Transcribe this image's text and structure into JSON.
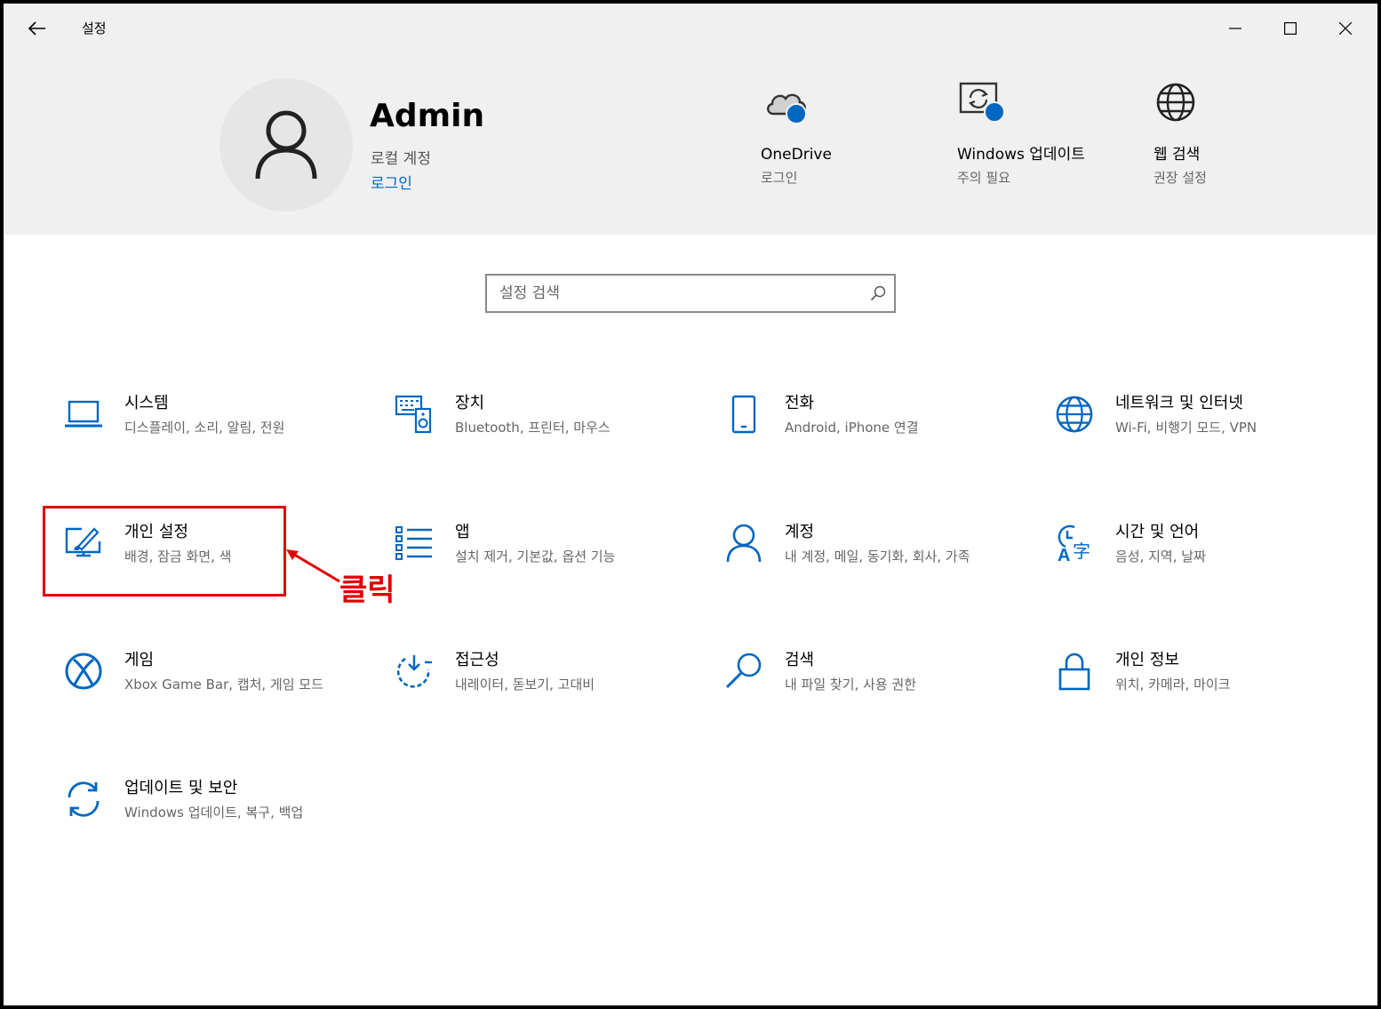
{
  "window": {
    "title": "설정"
  },
  "account": {
    "name": "Admin",
    "type": "로컬 계정",
    "signin": "로그인"
  },
  "quick": [
    {
      "title": "OneDrive",
      "sub": "로그인",
      "icon": "cloud-icon"
    },
    {
      "title": "Windows 업데이트",
      "sub": "주의 필요",
      "icon": "update-screen-icon"
    },
    {
      "title": "웹 검색",
      "sub": "권장 설정",
      "icon": "globe-icon"
    }
  ],
  "search": {
    "placeholder": "설정 검색"
  },
  "categories": [
    {
      "title": "시스템",
      "desc": "디스플레이, 소리, 알림, 전원",
      "icon": "laptop-icon"
    },
    {
      "title": "장치",
      "desc": "Bluetooth, 프린터, 마우스",
      "icon": "keyboard-speaker-icon"
    },
    {
      "title": "전화",
      "desc": "Android, iPhone 연결",
      "icon": "phone-icon"
    },
    {
      "title": "네트워크 및 인터넷",
      "desc": "Wi-Fi, 비행기 모드, VPN",
      "icon": "globe-icon"
    },
    {
      "title": "개인 설정",
      "desc": "배경, 잠금 화면, 색",
      "icon": "paintbrush-monitor-icon"
    },
    {
      "title": "앱",
      "desc": "설치 제거, 기본값, 옵션 기능",
      "icon": "list-icon"
    },
    {
      "title": "계정",
      "desc": "내 계정, 메일, 동기화, 회사, 가족",
      "icon": "person-icon"
    },
    {
      "title": "시간 및 언어",
      "desc": "음성, 지역, 날짜",
      "icon": "time-language-icon"
    },
    {
      "title": "게임",
      "desc": "Xbox Game Bar, 캡처, 게임 모드",
      "icon": "xbox-icon"
    },
    {
      "title": "접근성",
      "desc": "내레이터, 돋보기, 고대비",
      "icon": "ease-of-access-icon"
    },
    {
      "title": "검색",
      "desc": "내 파일 찾기, 사용 권한",
      "icon": "search-icon"
    },
    {
      "title": "개인 정보",
      "desc": "위치, 카메라, 마이크",
      "icon": "lock-icon"
    },
    {
      "title": "업데이트 및 보안",
      "desc": "Windows 업데이트, 복구, 백업",
      "icon": "sync-icon"
    }
  ],
  "annotation": {
    "label": "클릭",
    "color": "#e00000"
  },
  "colors": {
    "accent": "#0067c0",
    "header_bg": "#f0f0f0"
  }
}
